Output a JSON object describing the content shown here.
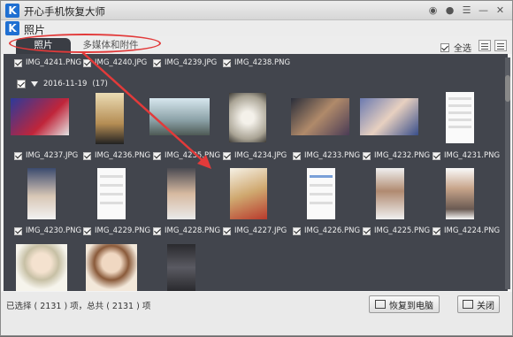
{
  "window": {
    "title": "开心手机恢复大师",
    "logo": "K"
  },
  "section": {
    "title": "照片",
    "logo": "K"
  },
  "titlebar_icons": [
    "wechat-icon",
    "chat-bubble-icon",
    "menu-icon",
    "minimize-icon",
    "close-icon"
  ],
  "tabs": [
    {
      "label": "照片",
      "active": true
    },
    {
      "label": "多媒体和附件",
      "active": false
    }
  ],
  "select_all": {
    "label": "全选",
    "checked": true
  },
  "view_buttons": [
    "grid-view-icon",
    "list-view-icon"
  ],
  "top_row_files": [
    "IMG_4241.PNG",
    "IMG_4240.JPG",
    "IMG_4239.JPG",
    "IMG_4238.PNG"
  ],
  "group": {
    "date": "2016-11-19",
    "count": "(17)"
  },
  "row1_files": [
    "IMG_4237.JPG",
    "IMG_4236.PNG",
    "IMG_4235.PNG",
    "IMG_4234.JPG",
    "IMG_4233.PNG",
    "IMG_4232.PNG",
    "IMG_4231.PNG"
  ],
  "row2_files": [
    "IMG_4230.PNG",
    "IMG_4229.PNG",
    "IMG_4228.PNG",
    "IMG_4227.JPG",
    "IMG_4226.PNG",
    "IMG_4225.PNG",
    "IMG_4224.PNG"
  ],
  "status": {
    "text": "已选择 ( 2131 ) 项，总共 ( 2131 ) 项"
  },
  "buttons": {
    "restore": "恢复到电脑",
    "close": "关闭"
  },
  "colors": {
    "accent": "#1f6fd2",
    "content_bg": "#42454d",
    "annotation_red": "#e23a3a"
  }
}
